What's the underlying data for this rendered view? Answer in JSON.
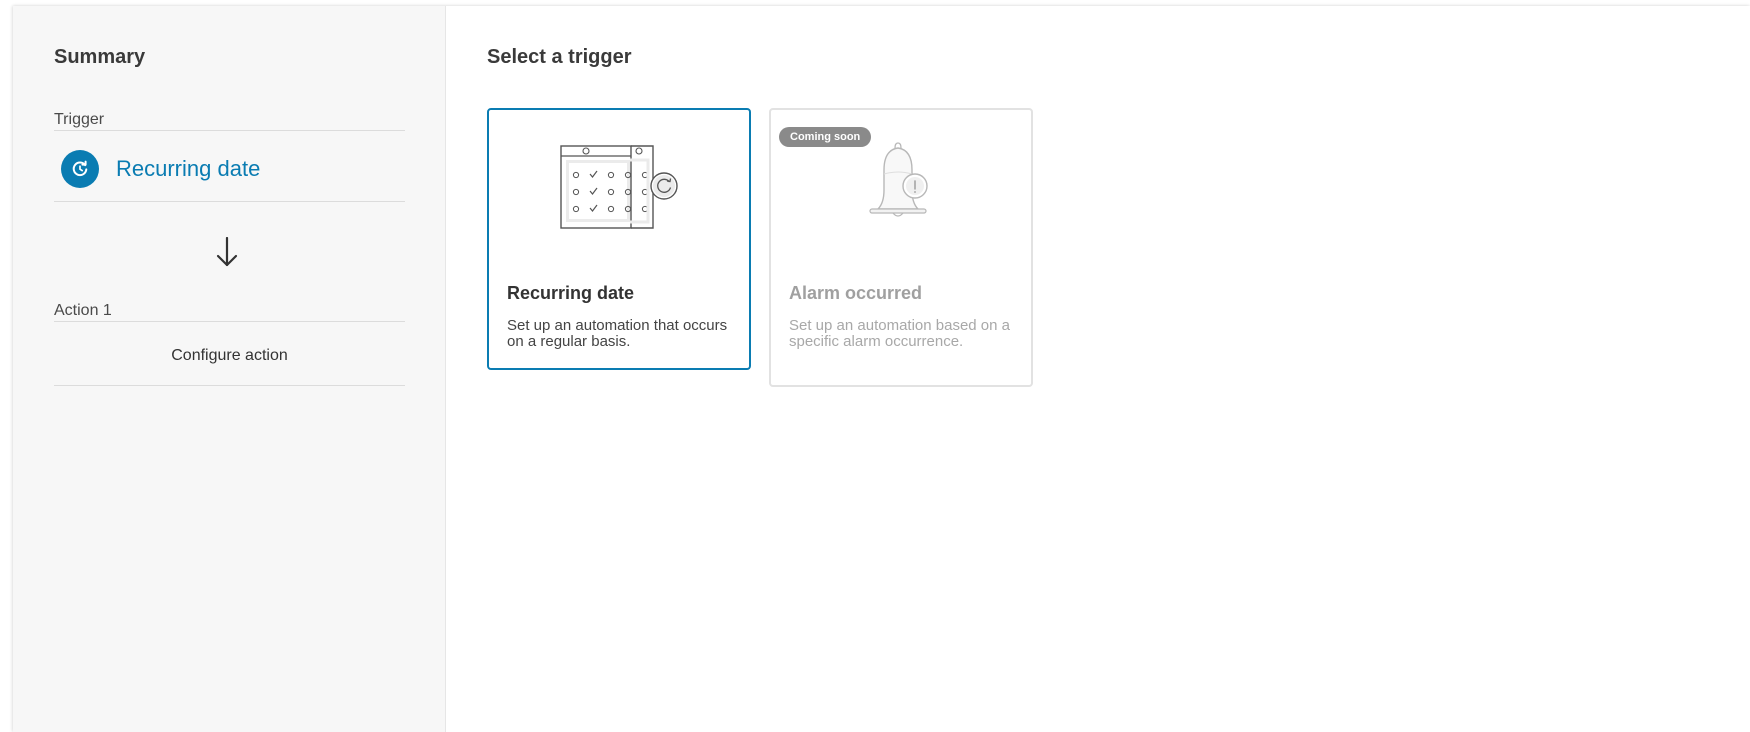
{
  "sidebar": {
    "title": "Summary",
    "trigger": {
      "label": "Trigger",
      "selected_name": "Recurring date",
      "icon": "recurring-icon"
    },
    "arrow_icon": "arrow-down-icon",
    "action": {
      "label": "Action 1",
      "configure_label": "Configure action"
    }
  },
  "main": {
    "title": "Select a trigger",
    "cards": [
      {
        "title": "Recurring date",
        "description": "Set up an automation that occurs on a regular basis.",
        "icon": "calendar-recurring-icon",
        "state": "selected"
      },
      {
        "title": "Alarm occurred",
        "description": "Set up an automation based on a specific alarm occurrence.",
        "icon": "alarm-bell-icon",
        "badge": "Coming soon",
        "state": "disabled"
      }
    ]
  },
  "colors": {
    "accent": "#0a7cb2",
    "sidebar_bg": "#f7f7f7",
    "badge_bg": "#8a8a8a",
    "disabled_text": "#a0a0a0"
  }
}
